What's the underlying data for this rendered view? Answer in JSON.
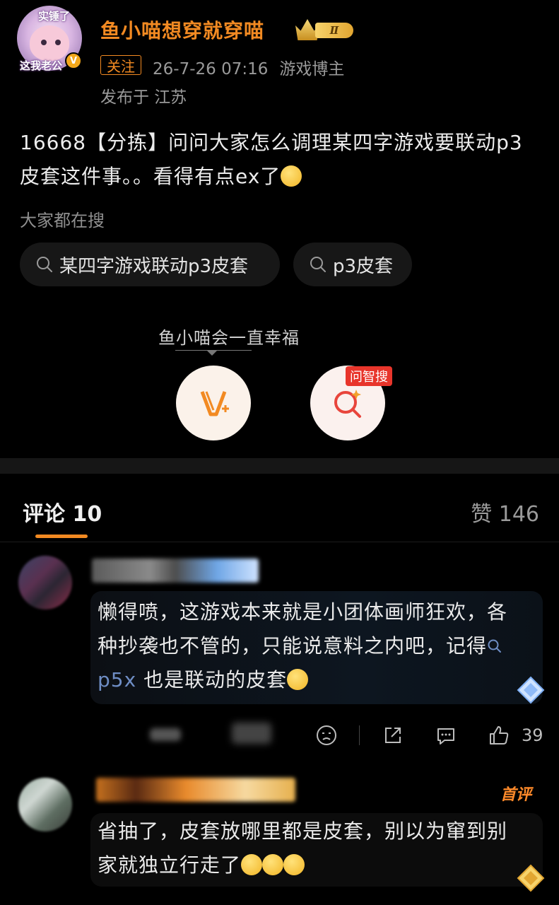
{
  "post": {
    "avatar_caption_top": "实锤了",
    "avatar_caption_bottom": "这我老公",
    "verified_badge": "V",
    "username": "鱼小喵想穿就穿喵",
    "level_badge": "Ⅱ",
    "follow_label": "关注",
    "timestamp": "26-7-26 07:16",
    "role": "游戏博主",
    "location": "发布于 江苏",
    "text": "16668【分拣】问问大家怎么调理某四字游戏要联动p3皮套这件事。。看得有点ex了"
  },
  "search": {
    "hint": "大家都在搜",
    "chips": [
      "某四字游戏联动p3皮套",
      "p3皮套"
    ]
  },
  "float": {
    "bubble_text": "鱼小喵会一直幸福",
    "zhisou_tag": "问智搜"
  },
  "tabs": {
    "comments_label": "评论 10",
    "likes_label": "赞 146"
  },
  "comments": [
    {
      "text_before": "懒得喷，这游戏本来就是小团体画师狂欢，各种抄袭也不管的，只能说意料之内吧，记得",
      "link": "p5x",
      "text_after": " 也是联动的皮套",
      "likes": "39"
    },
    {
      "badge": "首评",
      "text": "省抽了，皮套放哪里都是皮套，别以为窜到别家就独立行走了"
    }
  ],
  "colors": {
    "accent": "#f28a22",
    "background": "#000000",
    "link": "#6e8dc4",
    "tag_red": "#e8352b"
  },
  "icons": [
    "search-icon",
    "v-plus-icon",
    "ai-search-icon",
    "emoji-icon",
    "share-icon",
    "comment-icon",
    "like-icon",
    "diamond-icon"
  ]
}
